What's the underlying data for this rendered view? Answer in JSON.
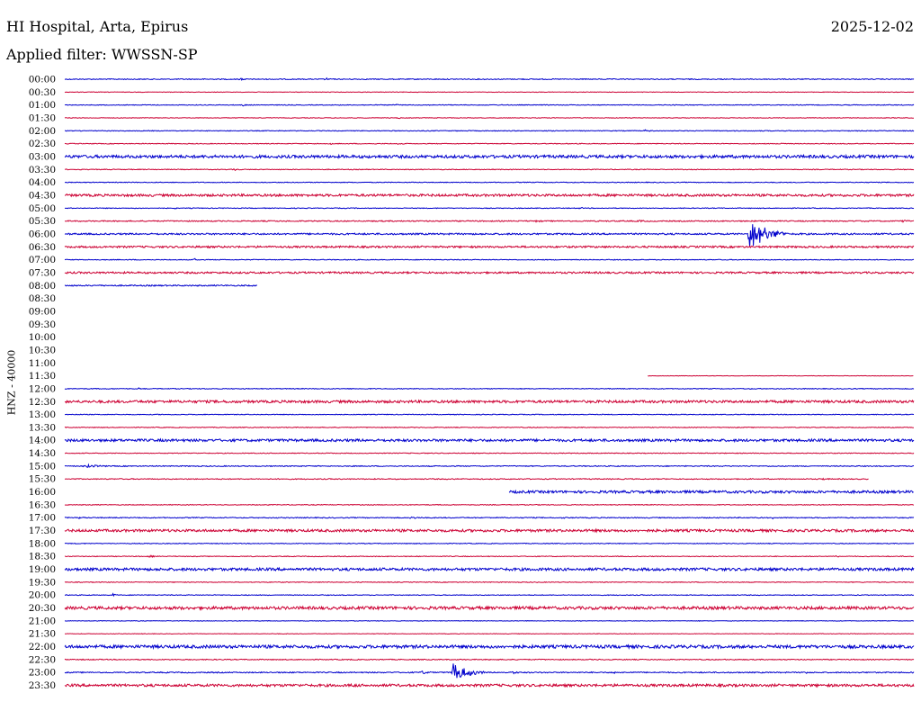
{
  "header": {
    "title": "HI Hospital, Arta, Epirus",
    "filter": "Applied filter: WWSSN-SP",
    "date": "2025-12-02",
    "channel": "HNZ - 40000"
  },
  "chart_data": {
    "type": "line",
    "title": "HI Hospital, Arta, Epirus",
    "subtitle": "Applied filter: WWSSN-SP",
    "date": "2025-12-02",
    "ylabel": "HNZ - 40000",
    "colors": [
      "#0000cc",
      "#cc0033"
    ],
    "grid": false,
    "legend": "none",
    "x_range_minutes": [
      0,
      30
    ],
    "rows": [
      {
        "label": "00:00",
        "start": 0,
        "end": 30,
        "noise": 0.5,
        "events": [
          {
            "t": 6.2,
            "amp": 1.5,
            "dur": 0.1
          },
          {
            "t": 9.2,
            "amp": 2,
            "dur": 0.1
          }
        ]
      },
      {
        "label": "00:30",
        "start": 0,
        "end": 30,
        "noise": 0.3,
        "events": []
      },
      {
        "label": "01:00",
        "start": 0,
        "end": 30,
        "noise": 0.4,
        "events": [
          {
            "t": 6.3,
            "amp": 1.5,
            "dur": 0.1
          },
          {
            "t": 11.7,
            "amp": 1.5,
            "dur": 0.1
          }
        ]
      },
      {
        "label": "01:30",
        "start": 0,
        "end": 30,
        "noise": 0.3,
        "events": [
          {
            "t": 11.8,
            "amp": 1.2,
            "dur": 0.1
          }
        ]
      },
      {
        "label": "02:00",
        "start": 0,
        "end": 30,
        "noise": 0.4,
        "events": [
          {
            "t": 20.5,
            "amp": 2,
            "dur": 0.1
          }
        ]
      },
      {
        "label": "02:30",
        "start": 0,
        "end": 30,
        "noise": 0.4,
        "events": [
          {
            "t": 9.4,
            "amp": 1.2,
            "dur": 0.1
          },
          {
            "t": 11.8,
            "amp": 1.5,
            "dur": 0.1
          },
          {
            "t": 25.3,
            "amp": 1.2,
            "dur": 0.1
          }
        ]
      },
      {
        "label": "03:00",
        "start": 0,
        "end": 30,
        "noise": 1.6,
        "events": []
      },
      {
        "label": "03:30",
        "start": 0,
        "end": 30,
        "noise": 0.4,
        "events": [
          {
            "t": 6.0,
            "amp": 1,
            "dur": 0.1
          }
        ]
      },
      {
        "label": "04:00",
        "start": 0,
        "end": 30,
        "noise": 0.4,
        "events": []
      },
      {
        "label": "04:30",
        "start": 0,
        "end": 30,
        "noise": 1.3,
        "events": []
      },
      {
        "label": "05:00",
        "start": 0,
        "end": 30,
        "noise": 0.4,
        "events": [
          {
            "t": 3.9,
            "amp": 1.5,
            "dur": 0.1
          },
          {
            "t": 18.2,
            "amp": 1.2,
            "dur": 0.1
          }
        ]
      },
      {
        "label": "05:30",
        "start": 0,
        "end": 30,
        "noise": 0.6,
        "events": [
          {
            "t": 16.7,
            "amp": 1.2,
            "dur": 0.1
          },
          {
            "t": 20.3,
            "amp": 1.2,
            "dur": 0.1
          },
          {
            "t": 28.2,
            "amp": 1.2,
            "dur": 0.1
          },
          {
            "t": 29.6,
            "amp": 2,
            "dur": 0.15
          }
        ]
      },
      {
        "label": "06:00",
        "start": 0,
        "end": 30,
        "noise": 0.9,
        "events": [
          {
            "t": 24.2,
            "amp": 17,
            "dur": 0.6
          }
        ]
      },
      {
        "label": "06:30",
        "start": 0,
        "end": 30,
        "noise": 1.0,
        "events": []
      },
      {
        "label": "07:00",
        "start": 0,
        "end": 30,
        "noise": 0.4,
        "events": [
          {
            "t": 4.6,
            "amp": 1.5,
            "dur": 0.1
          }
        ]
      },
      {
        "label": "07:30",
        "start": 0,
        "end": 30,
        "noise": 1.0,
        "events": []
      },
      {
        "label": "08:00",
        "start": 0,
        "end": 6.8,
        "noise": 0.7,
        "events": []
      },
      {
        "label": "08:30",
        "start": null,
        "end": null,
        "noise": 0,
        "events": []
      },
      {
        "label": "09:00",
        "start": null,
        "end": null,
        "noise": 0,
        "events": []
      },
      {
        "label": "09:30",
        "start": null,
        "end": null,
        "noise": 0,
        "events": []
      },
      {
        "label": "10:00",
        "start": null,
        "end": null,
        "noise": 0,
        "events": []
      },
      {
        "label": "10:30",
        "start": null,
        "end": null,
        "noise": 0,
        "events": []
      },
      {
        "label": "11:00",
        "start": null,
        "end": null,
        "noise": 0,
        "events": []
      },
      {
        "label": "11:30",
        "start": 20.6,
        "end": 30,
        "noise": 0.2,
        "events": []
      },
      {
        "label": "12:00",
        "start": 0,
        "end": 30,
        "noise": 0.4,
        "events": [
          {
            "t": 2.6,
            "amp": 1.2,
            "dur": 0.1
          }
        ]
      },
      {
        "label": "12:30",
        "start": 0,
        "end": 30,
        "noise": 1.4,
        "events": []
      },
      {
        "label": "13:00",
        "start": 0,
        "end": 30,
        "noise": 0.4,
        "events": []
      },
      {
        "label": "13:30",
        "start": 0,
        "end": 30,
        "noise": 0.4,
        "events": []
      },
      {
        "label": "14:00",
        "start": 0,
        "end": 30,
        "noise": 1.4,
        "events": []
      },
      {
        "label": "14:30",
        "start": 0,
        "end": 30,
        "noise": 0.4,
        "events": []
      },
      {
        "label": "15:00",
        "start": 0,
        "end": 30,
        "noise": 0.5,
        "events": [
          {
            "t": 0.7,
            "amp": 2.5,
            "dur": 0.35
          }
        ]
      },
      {
        "label": "15:30",
        "start": 0,
        "end": 28.4,
        "noise": 0.5,
        "events": [
          {
            "t": 26.8,
            "amp": 1.2,
            "dur": 0.1
          }
        ]
      },
      {
        "label": "16:00",
        "start": 15.7,
        "end": 30,
        "noise": 1.4,
        "events": []
      },
      {
        "label": "16:30",
        "start": 0,
        "end": 30,
        "noise": 0.4,
        "events": []
      },
      {
        "label": "17:00",
        "start": 0,
        "end": 30,
        "noise": 0.5,
        "events": [
          {
            "t": 0.5,
            "amp": 1.5,
            "dur": 0.1
          },
          {
            "t": 12.2,
            "amp": 1.5,
            "dur": 0.2
          },
          {
            "t": 17.6,
            "amp": 1.5,
            "dur": 0.1
          },
          {
            "t": 25.0,
            "amp": 1.2,
            "dur": 0.1
          }
        ]
      },
      {
        "label": "17:30",
        "start": 0,
        "end": 30,
        "noise": 1.4,
        "events": []
      },
      {
        "label": "18:00",
        "start": 0,
        "end": 30,
        "noise": 0.4,
        "events": []
      },
      {
        "label": "18:30",
        "start": 0,
        "end": 30,
        "noise": 0.4,
        "events": [
          {
            "t": 3.0,
            "amp": 1.2,
            "dur": 0.1
          },
          {
            "t": 27.3,
            "amp": 1.2,
            "dur": 0.1
          }
        ]
      },
      {
        "label": "19:00",
        "start": 0,
        "end": 30,
        "noise": 1.5,
        "events": []
      },
      {
        "label": "19:30",
        "start": 0,
        "end": 30,
        "noise": 0.4,
        "events": []
      },
      {
        "label": "20:00",
        "start": 0,
        "end": 30,
        "noise": 0.4,
        "events": [
          {
            "t": 1.7,
            "amp": 1.5,
            "dur": 0.1
          }
        ]
      },
      {
        "label": "20:30",
        "start": 0,
        "end": 30,
        "noise": 1.6,
        "events": []
      },
      {
        "label": "21:00",
        "start": 0,
        "end": 30,
        "noise": 0.3,
        "events": []
      },
      {
        "label": "21:30",
        "start": 0,
        "end": 30,
        "noise": 0.3,
        "events": []
      },
      {
        "label": "22:00",
        "start": 0,
        "end": 30,
        "noise": 1.7,
        "events": []
      },
      {
        "label": "22:30",
        "start": 0,
        "end": 30,
        "noise": 0.5,
        "events": []
      },
      {
        "label": "23:00",
        "start": 0,
        "end": 30,
        "noise": 0.6,
        "events": [
          {
            "t": 12.6,
            "amp": 2,
            "dur": 0.2
          },
          {
            "t": 13.7,
            "amp": 11,
            "dur": 0.5
          },
          {
            "t": 15.8,
            "amp": 2,
            "dur": 0.15
          },
          {
            "t": 19.4,
            "amp": 2,
            "dur": 0.15
          },
          {
            "t": 26.1,
            "amp": 1.5,
            "dur": 0.1
          }
        ]
      },
      {
        "label": "23:30",
        "start": 0,
        "end": 30,
        "noise": 1.4,
        "events": [
          {
            "t": 10.0,
            "amp": 1.5,
            "dur": 0.15
          }
        ]
      }
    ]
  }
}
